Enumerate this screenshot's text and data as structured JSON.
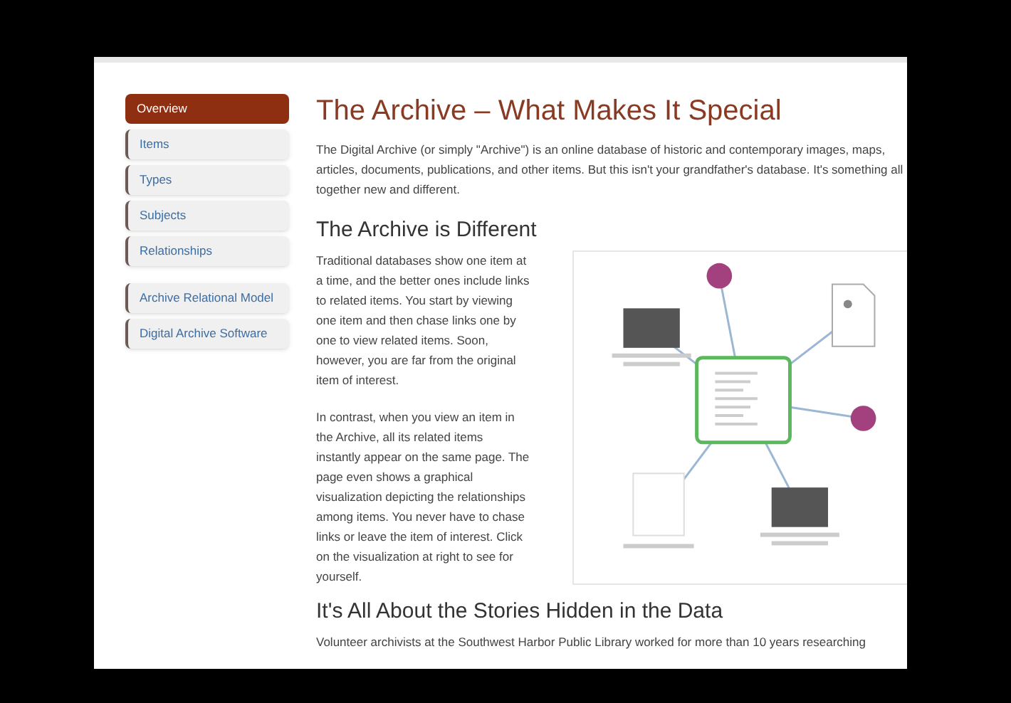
{
  "sidebar": {
    "groups": [
      [
        {
          "label": "Overview",
          "selected": true
        },
        {
          "label": "Items",
          "selected": false
        },
        {
          "label": "Types",
          "selected": false
        },
        {
          "label": "Subjects",
          "selected": false
        },
        {
          "label": "Relationships",
          "selected": false
        }
      ],
      [
        {
          "label": "Archive Relational Model",
          "selected": false
        },
        {
          "label": "Digital Archive Software",
          "selected": false
        }
      ]
    ]
  },
  "title": "The Archive – What Makes It Special",
  "intro": "The Digital Archive (or simply \"Archive\") is an online database of historic and contemporary images, maps, articles, documents, publications, and other items. But this isn't your grandfather's database. It's something all together new and different.",
  "sections": [
    {
      "heading": "The Archive is Different",
      "paragraphs": [
        "Traditional databases show one item at a time, and the better ones include links to related items. You start by viewing one item and then chase links one by one to view related items. Soon, however, you are far from the original item of interest.",
        "In contrast, when you view an item in the Archive, all its related items instantly appear on the same page. The page even shows a graphical visualization depicting the relationships among items. You never have to chase links or leave the item of interest. Click on the visualization at right to see for yourself."
      ]
    },
    {
      "heading": "It's All About the Stories Hidden in the Data",
      "paragraphs": [
        "Volunteer archivists at the Southwest Harbor Public Library worked for more than 10 years researching"
      ]
    }
  ]
}
